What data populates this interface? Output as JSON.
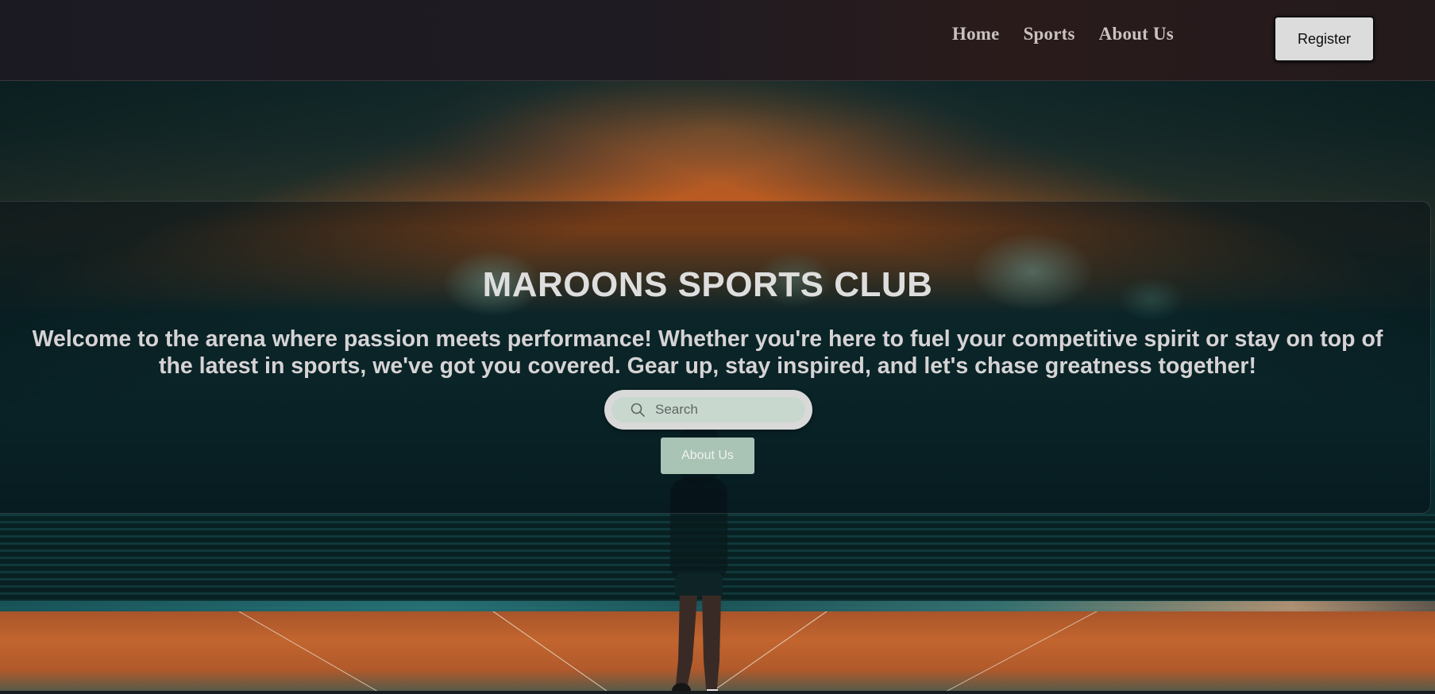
{
  "nav": {
    "links": [
      {
        "label": "Home"
      },
      {
        "label": "Sports"
      },
      {
        "label": "About Us"
      }
    ],
    "register_label": "Register"
  },
  "hero": {
    "title": "MAROONS SPORTS CLUB",
    "subtitle": "Welcome to the arena where passion meets performance! Whether you're here to fuel your competitive spirit or stay on top of the latest in sports, we've got you covered. Gear up, stay inspired, and let's chase greatness together!",
    "search": {
      "placeholder": "Search",
      "value": ""
    },
    "about_button_label": "About Us",
    "background_image": "stadium-runner-photo"
  },
  "colors": {
    "navbar": "#1f1b22",
    "register_bg": "#dddcdc",
    "about_btn_bg": "#a9c3b5",
    "search_bg": "#d9d9d9",
    "title_text": "#dedede"
  }
}
